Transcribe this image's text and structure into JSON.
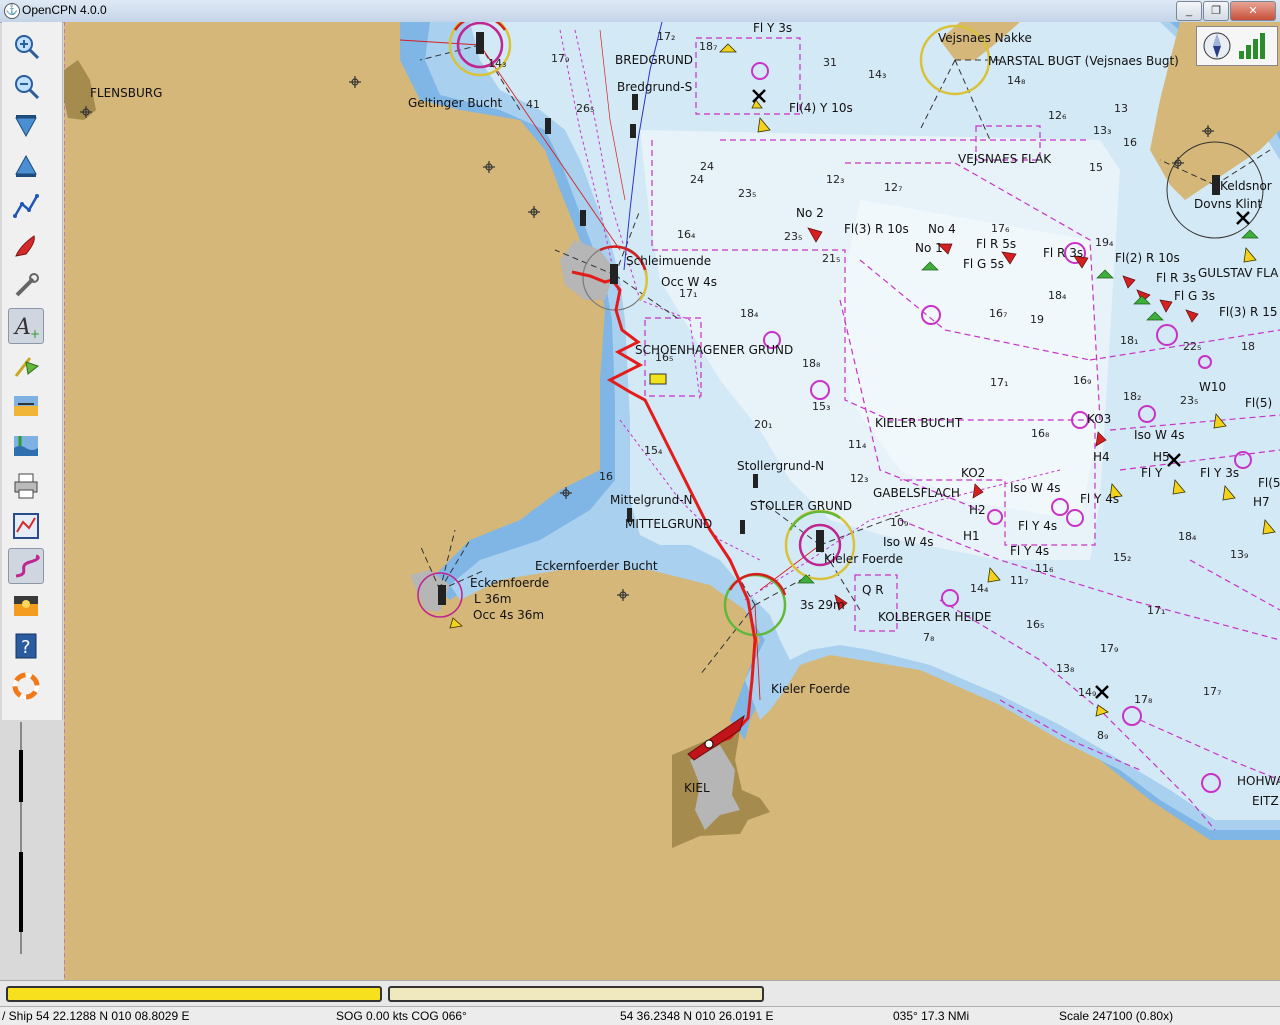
{
  "window": {
    "title": "OpenCPN 4.0.0",
    "app_icon": "opencpn-icon"
  },
  "toolbar": {
    "tools": [
      {
        "name": "zoom-in-icon",
        "active": false
      },
      {
        "name": "zoom-out-icon",
        "active": false
      },
      {
        "name": "scale-down-icon",
        "active": false
      },
      {
        "name": "scale-up-icon",
        "active": false
      },
      {
        "name": "route-icon",
        "active": false
      },
      {
        "name": "follow-ship-icon",
        "active": false
      },
      {
        "name": "settings-icon",
        "active": false
      },
      {
        "name": "text-icon",
        "active": true
      },
      {
        "name": "waypoint-icon",
        "active": false
      },
      {
        "name": "current-icon",
        "active": false
      },
      {
        "name": "tide-icon",
        "active": false
      },
      {
        "name": "print-icon",
        "active": false
      },
      {
        "name": "route-manager-icon",
        "active": false
      },
      {
        "name": "track-icon",
        "active": true
      },
      {
        "name": "color-scheme-icon",
        "active": false
      },
      {
        "name": "help-icon",
        "active": false
      },
      {
        "name": "mob-icon",
        "active": false
      }
    ]
  },
  "chart_labels": {
    "flensburg": "FLENSBURG",
    "geltinger": "Geltinger Bucht",
    "bredgrund": "BREDGRUND",
    "bredgrund_s": "Bredgrund-S",
    "fly3s": "Fl Y 3s",
    "fl4y10s": "Fl(4) Y 10s",
    "vejsnaes_nakke": "Vejsnaes Nakke",
    "marstal_bugt": "MARSTAL BUGT (Vejsnaes Bugt)",
    "vejsnaes_flak": "VEJSNAES FLAK",
    "dovns_klint": "Dovns Klint",
    "keldsnor": "Keldsnor",
    "gulstav": "GULSTAV FLA",
    "no2": "No 2",
    "fl3r10s": "Fl(3) R 10s",
    "no4": "No 4",
    "no1": "No 1",
    "flr5s": "Fl R 5s",
    "flg5s": "Fl G 5s",
    "flr3s": "Fl R 3s",
    "fl2r10s": "Fl(2) R 10s",
    "flr3s_b": "Fl R 3s",
    "flg3s": "Fl G 3s",
    "fl3r15": "Fl(3) R 15",
    "schleimuende": "Schleimuende",
    "occw4s": "Occ W 4s",
    "schoenhagener": "SCHOENHAGENER GRUND",
    "kieler_bucht": "KIELER BUCHT",
    "w10": "W10",
    "fl5": "Fl(5)",
    "ko3": "KO3",
    "isow4s": "Iso W 4s",
    "h4": "H4",
    "h5": "H5",
    "fly": "Fl Y",
    "stollergrund_n": "Stollergrund-N",
    "gabelsflach": "GABELSFLACH",
    "ko2": "KO2",
    "isow4s_b": "Iso W 4s",
    "fly4s": "Fl Y 4s",
    "mittelgrund_n": "Mittelgrund-N",
    "stoller_grund": "STOLLER GRUND",
    "mittelgrund": "MITTELGRUND",
    "h2": "H2",
    "h1": "H1",
    "fly4s_b": "Fl Y 4s",
    "fly4s_c": "Fl Y 4s",
    "fly4s_d": "Fl Y 4s",
    "fly3s_b": "Fl Y 3s",
    "kieler_foerde_light": "Kieler Foerde",
    "isow4s_c": "Iso W 4s",
    "eckernfoerder_bucht": "Eckernfoerder Bucht",
    "eckernfoerde": "Eckernfoerde",
    "l_36m": "L 36m",
    "occ4s36m": "Occ 4s 36m",
    "qr": "Q R",
    "kolberger": "KOLBERGER HEIDE",
    "kieler_foerde": "Kieler Foerde",
    "kiel": "KIEL",
    "hohwa": "HOHWA",
    "eitz": "EITZ",
    "w3s29m": "3s 29m",
    "h7": "H7"
  },
  "soundings": [
    {
      "v": "31"
    },
    {
      "v": "14₃"
    },
    {
      "v": "14₈"
    },
    {
      "v": "12₆"
    },
    {
      "v": "13₃"
    },
    {
      "v": "13"
    },
    {
      "v": "15"
    },
    {
      "v": "16"
    },
    {
      "v": "18₇"
    },
    {
      "v": "12₇"
    },
    {
      "v": "12₃"
    },
    {
      "v": "16₄"
    },
    {
      "v": "17₆"
    },
    {
      "v": "19₄"
    },
    {
      "v": "18₄"
    },
    {
      "v": "16₇"
    },
    {
      "v": "19"
    },
    {
      "v": "18₁"
    },
    {
      "v": "22₅"
    },
    {
      "v": "18"
    },
    {
      "v": "23₅"
    },
    {
      "v": "21₅"
    },
    {
      "v": "18₄"
    },
    {
      "v": "18₈"
    },
    {
      "v": "17₁"
    },
    {
      "v": "16₉"
    },
    {
      "v": "18₂"
    },
    {
      "v": "16₈"
    },
    {
      "v": "15₃"
    },
    {
      "v": "11₄"
    },
    {
      "v": "12₃"
    },
    {
      "v": "10₉"
    },
    {
      "v": "15₂"
    },
    {
      "v": "18₄"
    },
    {
      "v": "13₉"
    },
    {
      "v": "11₆"
    },
    {
      "v": "11₇"
    },
    {
      "v": "16₅"
    },
    {
      "v": "17₁"
    },
    {
      "v": "17₉"
    },
    {
      "v": "13₈"
    },
    {
      "v": "14₉"
    },
    {
      "v": "17₈"
    },
    {
      "v": "17₇"
    },
    {
      "v": "8₉"
    },
    {
      "v": "14₄"
    },
    {
      "v": "7₈"
    },
    {
      "v": "24"
    },
    {
      "v": "24"
    },
    {
      "v": "23₅"
    },
    {
      "v": "20₁"
    },
    {
      "v": "15₄"
    },
    {
      "v": "16₅"
    },
    {
      "v": "17₁"
    },
    {
      "v": "23₅"
    },
    {
      "v": "16"
    },
    {
      "v": "14₃"
    },
    {
      "v": "41"
    },
    {
      "v": "26₅"
    },
    {
      "v": "17₉"
    },
    {
      "v": "17₂"
    }
  ],
  "quilt_bar": {
    "active_color": "#f7e11f",
    "inactive_color": "#f0e9c0"
  },
  "status": {
    "ship": "/ Ship 54 22.1288 N   010 08.8029 E",
    "sog": "SOG 0.00 kts  COG 066°",
    "cursor": "54 36.2348 N   010 26.0191 E",
    "bearing": "035°  17.3 NMi",
    "scale": "Scale 247100 (0.80x)"
  },
  "colors": {
    "land": "#d4b779",
    "shallow": "#7fb6e6",
    "medium": "#a9d0ee",
    "deep": "#d4e9f6",
    "deepest": "#e8f3f9",
    "magenta": "#c832c8",
    "track": "#e41b1b"
  }
}
